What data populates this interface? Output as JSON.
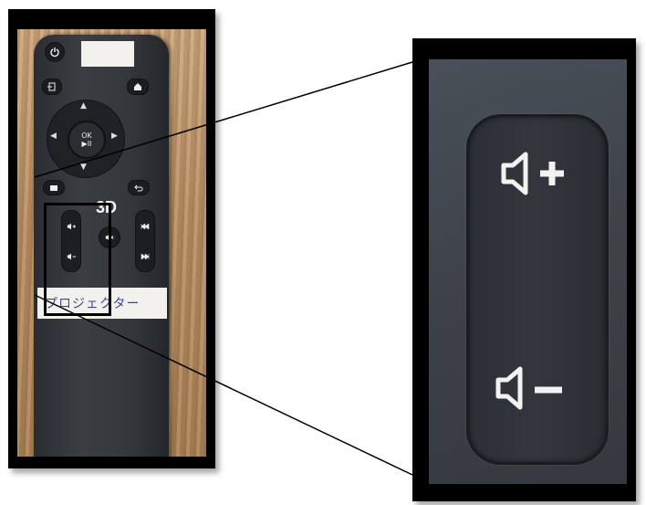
{
  "remote": {
    "ok_label": "OK\n▶II",
    "label_3d": "3D",
    "band_text": "プロジェクター"
  },
  "colors": {
    "frame": "#000000",
    "remote_body": "#34383c",
    "zoom_line": "#000000"
  },
  "icons": [
    "power-icon",
    "input-icon",
    "home-icon",
    "menu-icon",
    "back-icon",
    "volume-up-icon",
    "volume-down-icon",
    "mute-icon",
    "previous-track-icon",
    "next-track-icon"
  ]
}
